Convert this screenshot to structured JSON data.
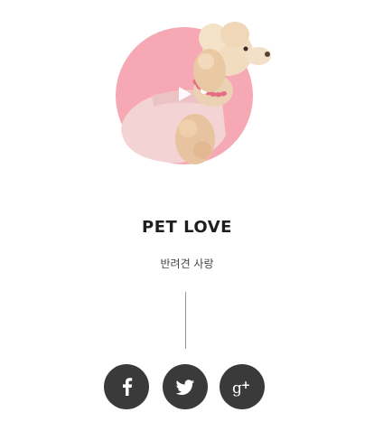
{
  "profile": {
    "title": "PET LOVE",
    "subtitle": "반려견 사랑",
    "avatar_icon": "poodle-photo",
    "accent_color": "#f6a9b4"
  },
  "social": {
    "buttons": [
      {
        "name": "facebook",
        "icon": "facebook-icon"
      },
      {
        "name": "twitter",
        "icon": "twitter-icon"
      },
      {
        "name": "google-plus",
        "icon": "google-plus-icon"
      }
    ],
    "button_color": "#3a3a3a"
  }
}
